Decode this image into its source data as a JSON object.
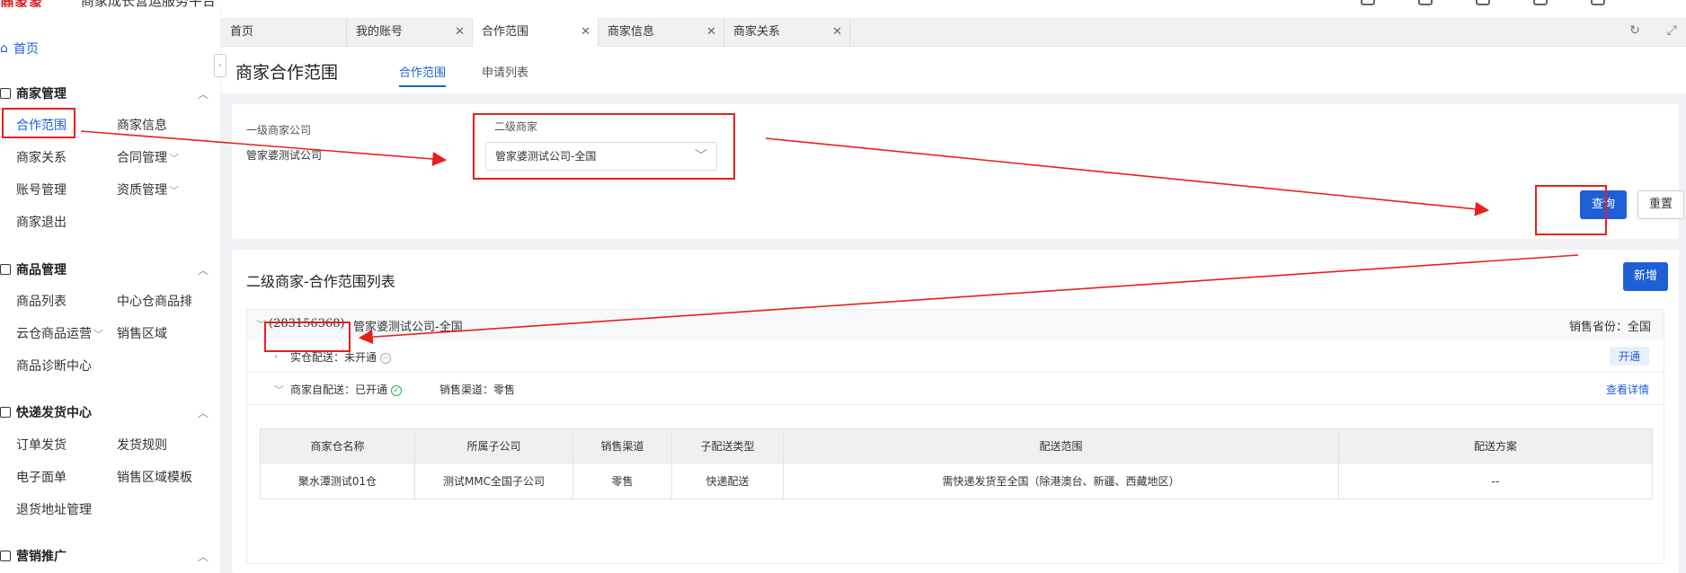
{
  "topbar": {
    "brand": "商家家",
    "brand_sub": "商家成长营运服务平台"
  },
  "sidebar": {
    "home": "首页",
    "sections": [
      {
        "title": "商家管理",
        "items": [
          "合作范围",
          "商家信息",
          "商家关系",
          "合同管理",
          "账号管理",
          "资质管理",
          "商家退出"
        ]
      },
      {
        "title": "商品管理",
        "items": [
          "商品列表",
          "中心仓商品排",
          "云仓商品运营",
          "销售区域",
          "商品诊断中心"
        ]
      },
      {
        "title": "快递发货中心",
        "items": [
          "订单发货",
          "发货规则",
          "电子面单",
          "销售区域模板",
          "退货地址管理"
        ]
      },
      {
        "title": "营销推广",
        "items": []
      }
    ]
  },
  "tabs": [
    "首页",
    "我的账号",
    "合作范围",
    "商家信息",
    "商家关系"
  ],
  "page": {
    "title": "商家合作范围",
    "tabs": [
      "合作范围",
      "申请列表"
    ]
  },
  "filter": {
    "level1_label": "一级商家公司",
    "level1_value": "管家婆测试公司",
    "level2_label": "二级商家",
    "level2_value": "管家婆测试公司-全国",
    "query_button": "查询",
    "reset_button": "重置"
  },
  "list": {
    "title": "二级商家-合作范围列表",
    "add_button": "新增",
    "group": {
      "id": "(283156368)",
      "name": "管家婆测试公司-全国",
      "province": "销售省份：全国",
      "row1": {
        "label": "实仓配送：未开通",
        "action": "开通"
      },
      "row2": {
        "label": "商家自配送：已开通",
        "channel": "销售渠道：零售",
        "action": "查看详情"
      }
    },
    "table": {
      "headers": [
        "商家仓名称",
        "所属子公司",
        "销售渠道",
        "子配送类型",
        "配送范围",
        "配送方案"
      ],
      "rows": [
        [
          "聚水潭测试01仓",
          "测试MMC全国子公司",
          "零售",
          "快递配送",
          "需快递发货至全国（除港澳台、新疆、西藏地区）",
          "--"
        ]
      ]
    }
  },
  "colors": {
    "accent": "#1e5fd6",
    "annotation": "#e8201c"
  }
}
